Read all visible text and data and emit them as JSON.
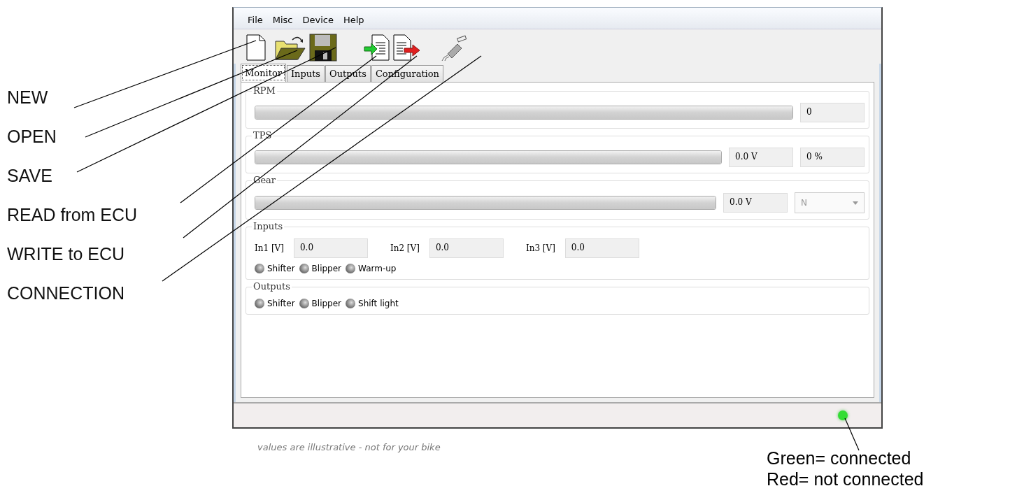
{
  "callouts": [
    {
      "label": "NEW"
    },
    {
      "label": "OPEN"
    },
    {
      "label": "SAVE"
    },
    {
      "label": "READ from ECU"
    },
    {
      "label": "WRITE to ECU"
    },
    {
      "label": "CONNECTION"
    }
  ],
  "window": {
    "menu": [
      "File",
      "Misc",
      "Device",
      "Help"
    ],
    "toolbar": [
      {
        "kind": "new"
      },
      {
        "kind": "open"
      },
      {
        "kind": "save"
      },
      {
        "kind": "read"
      },
      {
        "kind": "write"
      },
      {
        "kind": "connection"
      }
    ],
    "tabs": [
      {
        "label": "Monitor",
        "selected": true
      },
      {
        "label": "Inputs",
        "selected": false
      },
      {
        "label": "Outputs",
        "selected": false
      },
      {
        "label": "Configuration",
        "selected": false
      }
    ],
    "meters": [
      {
        "title": "RPM",
        "level": 1,
        "readings": [
          "0"
        ]
      },
      {
        "title": "TPS",
        "level": 1,
        "readings": [
          "0.0 V",
          "0 %"
        ]
      },
      {
        "title": "Gear",
        "level": 1,
        "readings": [
          "0.0 V"
        ],
        "dropdown": {
          "value": "N",
          "disabled": true
        }
      }
    ],
    "inputs": {
      "title": "Inputs",
      "fields": [
        {
          "label": "In1 [V]",
          "value": "0.0"
        },
        {
          "label": "In2 [V]",
          "value": "0.0"
        },
        {
          "label": "In3 [V]",
          "value": "0.0"
        }
      ],
      "lamps": [
        {
          "label": "Shifter",
          "on": false
        },
        {
          "label": "Blipper",
          "on": false
        },
        {
          "label": "Warm-up",
          "on": false
        }
      ]
    },
    "outputs": {
      "title": "Outputs",
      "lamps": [
        {
          "label": "Shifter",
          "on": false
        },
        {
          "label": "Blipper",
          "on": false
        },
        {
          "label": "Shift light",
          "on": false
        }
      ]
    },
    "status_bar": {
      "connected": true,
      "color": "#33dd33"
    }
  },
  "note": "values are illustrative - not for your bike",
  "legend": [
    "Green= connected",
    "Red= not connected"
  ]
}
